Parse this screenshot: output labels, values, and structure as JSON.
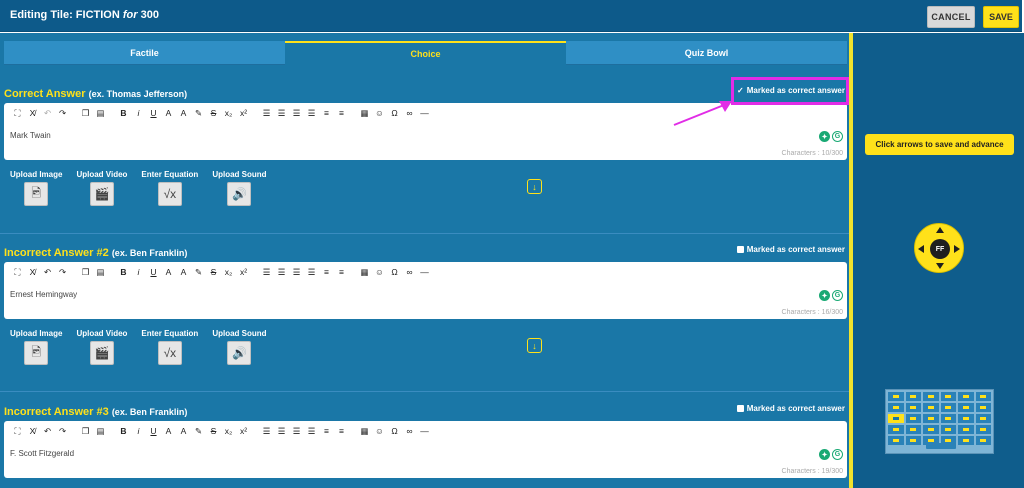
{
  "header": {
    "title_prefix": "Editing Tile: FICTION ",
    "title_for": "for",
    "title_points": " 300",
    "cancel_label": "CANCEL",
    "save_label": "SAVE"
  },
  "tabs": [
    {
      "label": "Factile",
      "active": false
    },
    {
      "label": "Choice",
      "active": true
    },
    {
      "label": "Quiz Bowl",
      "active": false
    }
  ],
  "answers": [
    {
      "title": "Correct Answer",
      "example": "(ex. Thomas Jefferson)",
      "marked_label": "Marked as correct answer",
      "marked": true,
      "text": "Mark Twain",
      "chars": "Characters : 10/300"
    },
    {
      "title": "Incorrect Answer #2",
      "example": "(ex. Ben Franklin)",
      "marked_label": "Marked as correct answer",
      "marked": false,
      "text": "Ernest Hemingway",
      "chars": "Characters : 16/300"
    },
    {
      "title": "Incorrect Answer #3",
      "example": "(ex. Ben Franklin)",
      "marked_label": "Marked as correct answer",
      "marked": false,
      "text": "F. Scott Fitzgerald",
      "chars": "Characters : 19/300"
    }
  ],
  "uploads": {
    "image": "Upload Image",
    "video": "Upload Video",
    "equation": "Enter Equation",
    "sound": "Upload Sound"
  },
  "sidebar": {
    "tip": "Click arrows to save and advance",
    "dpad_label": "FF"
  },
  "colors": {
    "accent": "#ffe11a",
    "panel": "#1a77a7",
    "header": "#0d5a8a",
    "highlight": "#e12ce6"
  }
}
